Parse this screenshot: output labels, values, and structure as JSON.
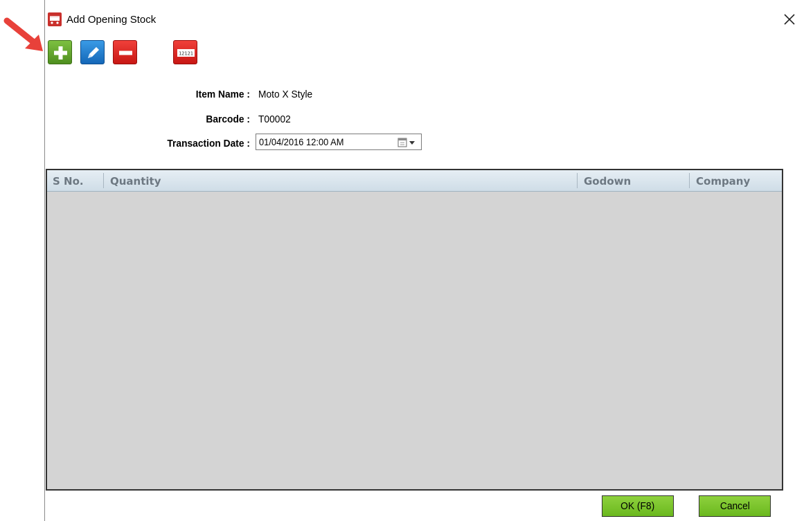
{
  "window": {
    "title": "Add Opening Stock"
  },
  "toolbar": {
    "barcode_icon_text": "12121"
  },
  "form": {
    "item_name_label": "Item Name :",
    "item_name_value": "Moto X Style",
    "barcode_label": "Barcode :",
    "barcode_value": "T00002",
    "transaction_date_label": "Transaction Date :",
    "transaction_date_value": "01/04/2016 12:00 AM"
  },
  "grid": {
    "columns": [
      "S No.",
      "Quantity",
      "Godown",
      "Company"
    ],
    "rows": []
  },
  "footer": {
    "ok_label": "OK (F8)",
    "cancel_label": "Cancel"
  },
  "colors": {
    "add": "#5aa02c",
    "edit": "#1e7fd6",
    "delete": "#e02521",
    "grid_background": "#d4d4d4",
    "button_green": "#7cc52d",
    "annotation_arrow": "#e8413a"
  }
}
